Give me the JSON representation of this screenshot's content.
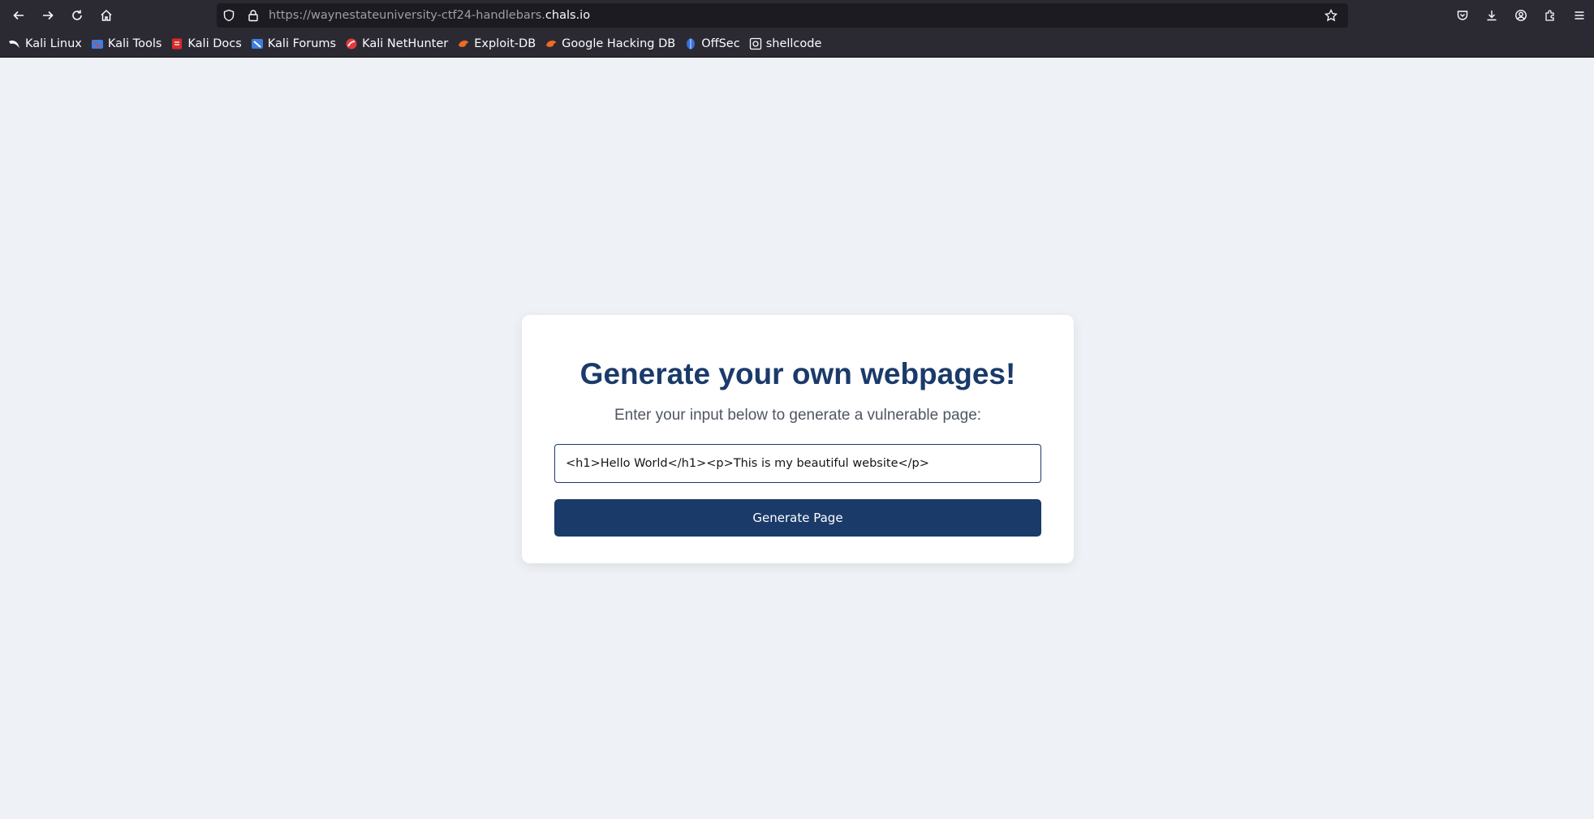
{
  "browser": {
    "url_prefix": "https://waynestateuniversity-ctf24-handlebars.",
    "url_domain": "chals.io",
    "nav_icons": [
      "back-arrow-icon",
      "forward-arrow-icon",
      "reload-icon",
      "home-icon"
    ],
    "url_icons": [
      "shield-icon",
      "lock-icon",
      "star-icon"
    ],
    "right_icons": [
      "pocket-icon",
      "download-icon",
      "account-icon",
      "extensions-icon",
      "menu-icon"
    ],
    "bookmarks": [
      {
        "label": "Kali Linux",
        "icon": "kali-dragon-icon"
      },
      {
        "label": "Kali Tools",
        "icon": "kali-tools-icon"
      },
      {
        "label": "Kali Docs",
        "icon": "kali-docs-icon"
      },
      {
        "label": "Kali Forums",
        "icon": "kali-forums-icon"
      },
      {
        "label": "Kali NetHunter",
        "icon": "nethunter-icon"
      },
      {
        "label": "Exploit-DB",
        "icon": "exploit-db-icon"
      },
      {
        "label": "Google Hacking DB",
        "icon": "ghdb-icon"
      },
      {
        "label": "OffSec",
        "icon": "offsec-icon"
      },
      {
        "label": "shellcode",
        "icon": "shellcode-icon"
      }
    ]
  },
  "page": {
    "title": "Generate your own webpages!",
    "subtitle": "Enter your input below to generate a vulnerable page:",
    "input_value": "<h1>Hello World</h1><p>This is my beautiful website</p>",
    "button_label": "Generate Page"
  },
  "colors": {
    "page_background": "#eef1f5",
    "accent": "#1a3a6a",
    "chrome": "#2b2a33"
  }
}
